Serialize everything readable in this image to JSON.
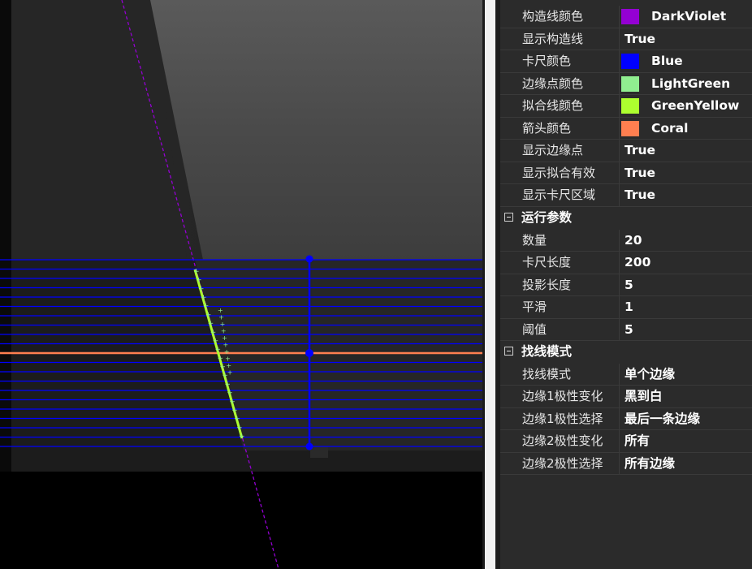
{
  "viewer": {
    "caliper": {
      "count": 20,
      "caliper_color": "#0000ff",
      "edge_point_color": "#90ee90",
      "fit_line_color": "#adff2f",
      "arrow_color": "#ff7f50",
      "construct_line_color": "#9400d3"
    }
  },
  "property_grid": {
    "top_partial_category": "",
    "rows_top": [
      {
        "label": "构造线颜色",
        "value": "DarkViolet",
        "swatch": "#9400d3"
      },
      {
        "label": "显示构造线",
        "value": "True"
      },
      {
        "label": "卡尺颜色",
        "value": "Blue",
        "swatch": "#0000ff"
      },
      {
        "label": "边缘点颜色",
        "value": "LightGreen",
        "swatch": "#90ee90"
      },
      {
        "label": "拟合线颜色",
        "value": "GreenYellow",
        "swatch": "#adff2f"
      },
      {
        "label": "箭头颜色",
        "value": "Coral",
        "swatch": "#ff7f50"
      },
      {
        "label": "显示边缘点",
        "value": "True"
      },
      {
        "label": "显示拟合有效",
        "value": "True"
      },
      {
        "label": "显示卡尺区域",
        "value": "True"
      }
    ],
    "cat_run": "运行参数",
    "rows_run": [
      {
        "label": "数量",
        "value": "20"
      },
      {
        "label": "卡尺长度",
        "value": "200"
      },
      {
        "label": "投影长度",
        "value": "5"
      },
      {
        "label": "平滑",
        "value": "1"
      },
      {
        "label": "阈值",
        "value": "5"
      }
    ],
    "cat_mode": "找线模式",
    "rows_mode": [
      {
        "label": "找线模式",
        "value": "单个边缘"
      },
      {
        "label": "边缘1极性变化",
        "value": "黑到白"
      },
      {
        "label": "边缘1极性选择",
        "value": "最后一条边缘"
      },
      {
        "label": "边缘2极性变化",
        "value": "所有"
      },
      {
        "label": "边缘2极性选择",
        "value": "所有边缘"
      }
    ]
  }
}
